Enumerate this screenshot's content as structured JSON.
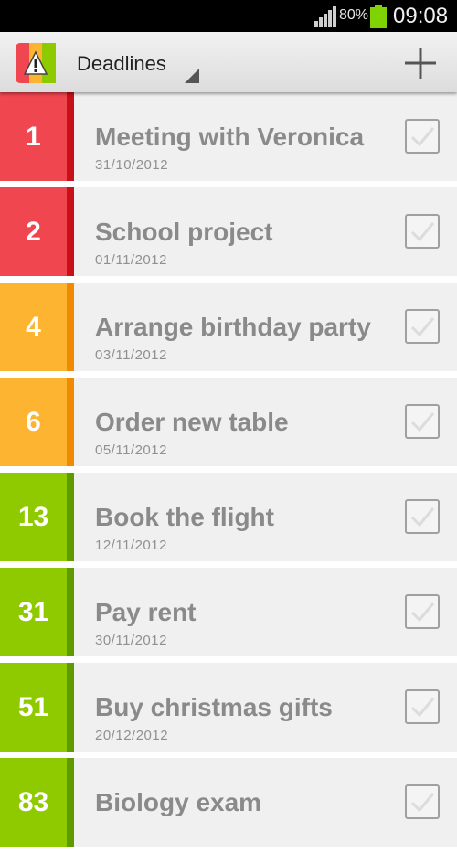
{
  "status_bar": {
    "battery_percent": "80%",
    "time": "09:08",
    "icons": [
      "signal-icon",
      "battery-icon"
    ]
  },
  "action_bar": {
    "title": "Deadlines",
    "icons": [
      "app-logo-icon",
      "dropdown-caret-icon",
      "plus-icon"
    ]
  },
  "colors": {
    "red": "#f04650",
    "red_accent": "#c8101a",
    "orange": "#fcb431",
    "orange_accent": "#f08a00",
    "green": "#8fc900",
    "green_accent": "#5f9a00"
  },
  "deadlines": [
    {
      "days": "1",
      "title": "Meeting with Veronica",
      "date": "31/10/2012",
      "urgency": "red"
    },
    {
      "days": "2",
      "title": "School project",
      "date": "01/11/2012",
      "urgency": "red"
    },
    {
      "days": "4",
      "title": "Arrange birthday party",
      "date": "03/11/2012",
      "urgency": "orange"
    },
    {
      "days": "6",
      "title": "Order new table",
      "date": "05/11/2012",
      "urgency": "orange"
    },
    {
      "days": "13",
      "title": "Book the flight",
      "date": "12/11/2012",
      "urgency": "green"
    },
    {
      "days": "31",
      "title": "Pay rent",
      "date": "30/11/2012",
      "urgency": "green"
    },
    {
      "days": "51",
      "title": "Buy christmas gifts",
      "date": "20/12/2012",
      "urgency": "green"
    },
    {
      "days": "83",
      "title": "Biology exam",
      "date": "",
      "urgency": "green"
    }
  ]
}
